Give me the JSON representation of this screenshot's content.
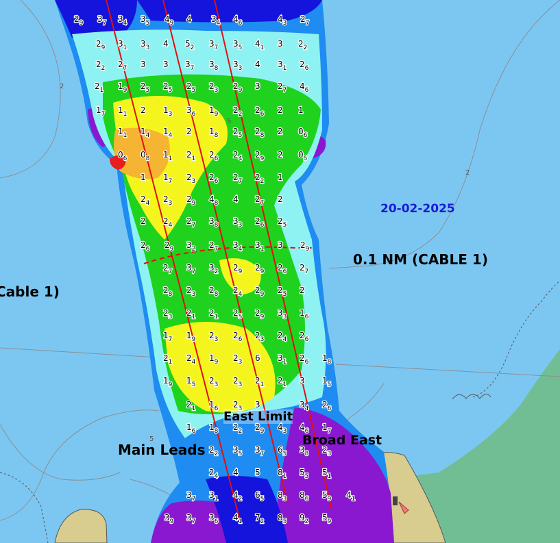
{
  "map": {
    "survey_date": "20-02-2025",
    "labels": {
      "cable_right": "0.1 NM (CABLE 1)",
      "cable_left": "Cable 1)",
      "east_limit": "East Limit",
      "broad_east": "Broad East",
      "main_leads": "Main Leads"
    },
    "chart_depths": [
      "2",
      "2",
      "5",
      "5"
    ],
    "colors": {
      "water": "#7cc7f2",
      "land_green": "#72be94",
      "land_sand": "#d8cc8e",
      "deep_purple": "#8a18d0",
      "deep_blue": "#1414dc",
      "mid_blue": "#1e8cf0",
      "cyan": "#8ef2f2",
      "green": "#1ed21e",
      "yellow": "#f5f51e",
      "orange": "#f5b432",
      "red": "#e61e1e",
      "leads_line": "#e01010"
    },
    "soundings": [
      {
        "d": "2",
        "s": "9"
      },
      {
        "d": "3",
        "s": "7"
      },
      {
        "d": "3",
        "s": "4"
      },
      {
        "d": "3",
        "s": "5"
      },
      {
        "d": "4",
        "s": "9"
      },
      {
        "d": "4",
        "s": ""
      },
      {
        "d": "3",
        "s": "4"
      },
      {
        "d": "4",
        "s": "6"
      },
      {
        "d": "4",
        "s": "3"
      },
      {
        "d": "2",
        "s": "7"
      },
      {
        "d": "2",
        "s": "9"
      },
      {
        "d": "3",
        "s": "1"
      },
      {
        "d": "3",
        "s": "3"
      },
      {
        "d": "4",
        "s": ""
      },
      {
        "d": "5",
        "s": "2"
      },
      {
        "d": "3",
        "s": "7"
      },
      {
        "d": "3",
        "s": "5"
      },
      {
        "d": "4",
        "s": "1"
      },
      {
        "d": "3",
        "s": ""
      },
      {
        "d": "2",
        "s": "2"
      },
      {
        "d": "2",
        "s": "2"
      },
      {
        "d": "2",
        "s": "7"
      },
      {
        "d": "3",
        "s": ""
      },
      {
        "d": "3",
        "s": ""
      },
      {
        "d": "3",
        "s": "7"
      },
      {
        "d": "3",
        "s": "8"
      },
      {
        "d": "3",
        "s": "3"
      },
      {
        "d": "4",
        "s": ""
      },
      {
        "d": "3",
        "s": "1"
      },
      {
        "d": "2",
        "s": "6"
      },
      {
        "d": "2",
        "s": "1"
      },
      {
        "d": "1",
        "s": "9"
      },
      {
        "d": "2",
        "s": "5"
      },
      {
        "d": "2",
        "s": "5"
      },
      {
        "d": "2",
        "s": "5"
      },
      {
        "d": "2",
        "s": "3"
      },
      {
        "d": "2",
        "s": "9"
      },
      {
        "d": "3",
        "s": ""
      },
      {
        "d": "2",
        "s": "7"
      },
      {
        "d": "4",
        "s": "6"
      },
      {
        "d": "1",
        "s": "7"
      },
      {
        "d": "1",
        "s": "1"
      },
      {
        "d": "2",
        "s": ""
      },
      {
        "d": "1",
        "s": "3"
      },
      {
        "d": "3",
        "s": "6"
      },
      {
        "d": "1",
        "s": "9"
      },
      {
        "d": "2",
        "s": "2"
      },
      {
        "d": "2",
        "s": "6"
      },
      {
        "d": "2",
        "s": ""
      },
      {
        "d": "1",
        "s": ""
      },
      {
        "d": "1",
        "s": "1"
      },
      {
        "d": "1",
        "s": "4"
      },
      {
        "d": "1",
        "s": "4"
      },
      {
        "d": "2",
        "s": ""
      },
      {
        "d": "1",
        "s": "8"
      },
      {
        "d": "2",
        "s": "5"
      },
      {
        "d": "2",
        "s": "8"
      },
      {
        "d": "2",
        "s": ""
      },
      {
        "d": "0",
        "s": "6"
      },
      {
        "d": "0",
        "s": "6"
      },
      {
        "d": "0",
        "s": "8"
      },
      {
        "d": "1",
        "s": "1"
      },
      {
        "d": "2",
        "s": "1"
      },
      {
        "d": "2",
        "s": "6"
      },
      {
        "d": "2",
        "s": "4"
      },
      {
        "d": "2",
        "s": "9"
      },
      {
        "d": "2",
        "s": ""
      },
      {
        "d": "0",
        "s": "5"
      },
      {
        "d": "1",
        "s": ""
      },
      {
        "d": "1",
        "s": "7"
      },
      {
        "d": "2",
        "s": "3"
      },
      {
        "d": "2",
        "s": "6"
      },
      {
        "d": "2",
        "s": "7"
      },
      {
        "d": "2",
        "s": "2"
      },
      {
        "d": "1",
        "s": ""
      },
      {
        "d": "2",
        "s": "4"
      },
      {
        "d": "2",
        "s": "3"
      },
      {
        "d": "2",
        "s": "9"
      },
      {
        "d": "4",
        "s": "8"
      },
      {
        "d": "4",
        "s": ""
      },
      {
        "d": "2",
        "s": "7"
      },
      {
        "d": "2",
        "s": ""
      },
      {
        "d": "2",
        "s": ""
      },
      {
        "d": "2",
        "s": "4"
      },
      {
        "d": "2",
        "s": "7"
      },
      {
        "d": "3",
        "s": "8"
      },
      {
        "d": "3",
        "s": "3"
      },
      {
        "d": "2",
        "s": "6"
      },
      {
        "d": "2",
        "s": "5"
      },
      {
        "d": "2",
        "s": "6"
      },
      {
        "d": "2",
        "s": "9"
      },
      {
        "d": "3",
        "s": "2"
      },
      {
        "d": "2",
        "s": "7"
      },
      {
        "d": "3",
        "s": "4"
      },
      {
        "d": "3",
        "s": "1"
      },
      {
        "d": "3",
        "s": ""
      },
      {
        "d": "2",
        "s": "9"
      },
      {
        "d": "2",
        "s": "7"
      },
      {
        "d": "3",
        "s": "7"
      },
      {
        "d": "3",
        "s": "2"
      },
      {
        "d": "2",
        "s": "9"
      },
      {
        "d": "2",
        "s": "9"
      },
      {
        "d": "2",
        "s": "6"
      },
      {
        "d": "2",
        "s": "7"
      },
      {
        "d": "2",
        "s": "8"
      },
      {
        "d": "2",
        "s": "3"
      },
      {
        "d": "2",
        "s": "8"
      },
      {
        "d": "2",
        "s": "4"
      },
      {
        "d": "2",
        "s": "9"
      },
      {
        "d": "2",
        "s": "5"
      },
      {
        "d": "2",
        "s": ""
      },
      {
        "d": "2",
        "s": "3"
      },
      {
        "d": "2",
        "s": "1"
      },
      {
        "d": "2",
        "s": "1"
      },
      {
        "d": "2",
        "s": "5"
      },
      {
        "d": "2",
        "s": "9"
      },
      {
        "d": "3",
        "s": "3"
      },
      {
        "d": "1",
        "s": "6"
      },
      {
        "d": "1",
        "s": "7"
      },
      {
        "d": "1",
        "s": "9"
      },
      {
        "d": "2",
        "s": "3"
      },
      {
        "d": "2",
        "s": "6"
      },
      {
        "d": "2",
        "s": "3"
      },
      {
        "d": "2",
        "s": "4"
      },
      {
        "d": "2",
        "s": "6"
      },
      {
        "d": "2",
        "s": "1"
      },
      {
        "d": "2",
        "s": "4"
      },
      {
        "d": "1",
        "s": "9"
      },
      {
        "d": "2",
        "s": "3"
      },
      {
        "d": "6",
        "s": ""
      },
      {
        "d": "3",
        "s": "1"
      },
      {
        "d": "2",
        "s": "6"
      },
      {
        "d": "1",
        "s": "8"
      },
      {
        "d": "1",
        "s": "9"
      },
      {
        "d": "1",
        "s": "5"
      },
      {
        "d": "2",
        "s": "3"
      },
      {
        "d": "2",
        "s": "3"
      },
      {
        "d": "2",
        "s": "1"
      },
      {
        "d": "2",
        "s": "1"
      },
      {
        "d": "3",
        "s": ""
      },
      {
        "d": "1",
        "s": "5"
      },
      {
        "d": "2",
        "s": "1"
      },
      {
        "d": "1",
        "s": "6"
      },
      {
        "d": "2",
        "s": "3"
      },
      {
        "d": "3",
        "s": ""
      },
      {
        "d": "3",
        "s": "4"
      },
      {
        "d": "2",
        "s": "6"
      },
      {
        "d": "1",
        "s": "6"
      },
      {
        "d": "1",
        "s": "8"
      },
      {
        "d": "2",
        "s": "2"
      },
      {
        "d": "2",
        "s": "9"
      },
      {
        "d": "4",
        "s": "3"
      },
      {
        "d": "4",
        "s": "6"
      },
      {
        "d": "1",
        "s": "7"
      },
      {
        "d": "2",
        "s": "2"
      },
      {
        "d": "3",
        "s": "5"
      },
      {
        "d": "3",
        "s": "7"
      },
      {
        "d": "6",
        "s": "5"
      },
      {
        "d": "3",
        "s": "8"
      },
      {
        "d": "2",
        "s": "3"
      },
      {
        "d": "2",
        "s": "4"
      },
      {
        "d": "4",
        "s": ""
      },
      {
        "d": "5",
        "s": ""
      },
      {
        "d": "8",
        "s": "1"
      },
      {
        "d": "5",
        "s": "5"
      },
      {
        "d": "5",
        "s": "1"
      },
      {
        "d": "3",
        "s": "7"
      },
      {
        "d": "3",
        "s": "1"
      },
      {
        "d": "4",
        "s": "2"
      },
      {
        "d": "6",
        "s": "5"
      },
      {
        "d": "8",
        "s": "3"
      },
      {
        "d": "8",
        "s": "6"
      },
      {
        "d": "5",
        "s": "9"
      },
      {
        "d": "4",
        "s": "1"
      },
      {
        "d": "3",
        "s": "9"
      },
      {
        "d": "3",
        "s": "7"
      },
      {
        "d": "3",
        "s": "6"
      },
      {
        "d": "4",
        "s": "1"
      },
      {
        "d": "7",
        "s": "2"
      },
      {
        "d": "8",
        "s": "5"
      },
      {
        "d": "9",
        "s": "2"
      },
      {
        "d": "5",
        "s": "9"
      }
    ]
  }
}
